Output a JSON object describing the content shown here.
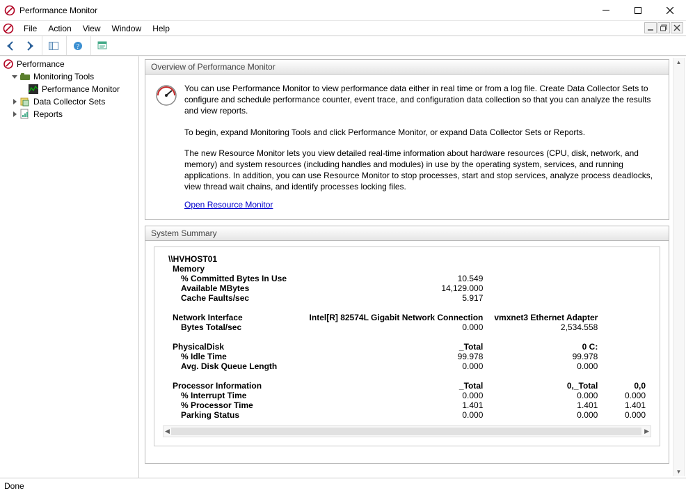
{
  "window": {
    "title": "Performance Monitor"
  },
  "menubar": {
    "items": [
      "File",
      "Action",
      "View",
      "Window",
      "Help"
    ]
  },
  "tree": {
    "root": "Performance",
    "nodes": {
      "monitoring_tools": "Monitoring Tools",
      "performance_monitor": "Performance Monitor",
      "data_collector_sets": "Data Collector Sets",
      "reports": "Reports"
    }
  },
  "overview": {
    "header": "Overview of Performance Monitor",
    "p1": "You can use Performance Monitor to view performance data either in real time or from a log file. Create Data Collector Sets to configure and schedule performance counter, event trace, and configuration data collection so that you can analyze the results and view reports.",
    "p2": "To begin, expand Monitoring Tools and click Performance Monitor, or expand Data Collector Sets or Reports.",
    "p3": "The new Resource Monitor lets you view detailed real-time information about hardware resources (CPU, disk, network, and memory) and system resources (including handles and modules) in use by the operating system, services, and running applications. In addition, you can use Resource Monitor to stop processes, start and stop services, analyze process deadlocks, view thread wait chains, and identify processes locking files.",
    "link_text": "Open Resource Monitor"
  },
  "summary": {
    "header": "System Summary",
    "host": "\\\\HVHOST01",
    "memory": {
      "label": "Memory",
      "rows": [
        {
          "name": "% Committed Bytes In Use",
          "value": "10.549"
        },
        {
          "name": "Available MBytes",
          "value": "14,129.000"
        },
        {
          "name": "Cache Faults/sec",
          "value": "5.917"
        }
      ]
    },
    "network": {
      "label": "Network Interface",
      "instances": [
        "Intel[R] 82574L Gigabit Network Connection",
        "vmxnet3 Ethernet Adapter"
      ],
      "rows": [
        {
          "name": "Bytes Total/sec",
          "values": [
            "0.000",
            "2,534.558"
          ]
        }
      ]
    },
    "disk": {
      "label": "PhysicalDisk",
      "instances": [
        "_Total",
        "0 C:"
      ],
      "rows": [
        {
          "name": "% Idle Time",
          "values": [
            "99.978",
            "99.978"
          ]
        },
        {
          "name": "Avg. Disk Queue Length",
          "values": [
            "0.000",
            "0.000"
          ]
        }
      ]
    },
    "processor": {
      "label": "Processor Information",
      "instances": [
        "_Total",
        "0,_Total",
        "0,0"
      ],
      "rows": [
        {
          "name": "% Interrupt Time",
          "values": [
            "0.000",
            "0.000",
            "0.000"
          ]
        },
        {
          "name": "% Processor Time",
          "values": [
            "1.401",
            "1.401",
            "1.401"
          ]
        },
        {
          "name": "Parking Status",
          "values": [
            "0.000",
            "0.000",
            "0.000"
          ]
        }
      ]
    }
  },
  "status": {
    "text": "Done"
  }
}
